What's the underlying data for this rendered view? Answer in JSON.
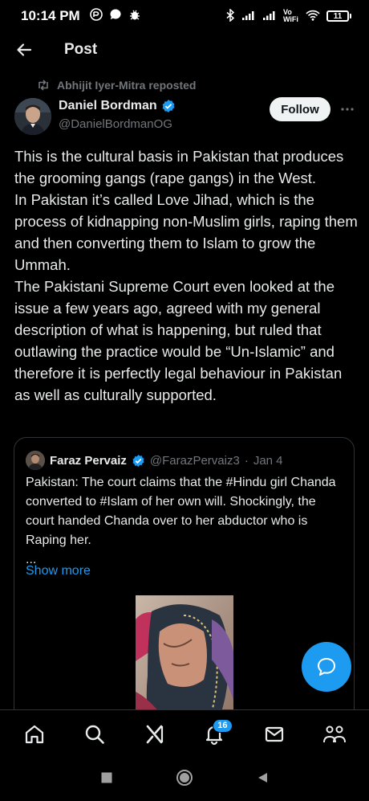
{
  "status_bar": {
    "time": "10:14 PM",
    "network_label": "Vo WiFi",
    "battery": "11"
  },
  "header": {
    "title": "Post"
  },
  "post": {
    "repost_text": "Abhijit Iyer-Mitra reposted",
    "author_name": "Daniel Bordman",
    "author_handle": "@DanielBordmanOG",
    "follow_label": "Follow",
    "paragraphs": [
      "This is the cultural basis in Pakistan that produces the grooming gangs (rape gangs) in the West.",
      "In Pakistan it’s called Love Jihad, which is the process of kidnapping non-Muslim girls, raping them and then converting them to Islam to grow the Ummah.",
      "The Pakistani Supreme Court even looked at the issue a few years ago, agreed with my general description of what is happening, but ruled that outlawing the practice would be “Un-Islamic” and therefore it is perfectly legal behaviour in Pakistan as well as culturally supported."
    ]
  },
  "quote": {
    "author_name": "Faraz Pervaiz",
    "author_handle": "@FarazPervaiz3",
    "separator": "·",
    "date": "Jan 4",
    "text": "Pakistan: The court claims that the #Hindu girl Chanda converted to #Islam of her own will. Shockingly, the court handed Chanda over to her abductor who is Raping her.",
    "ellipsis": "...",
    "show_more": "Show more"
  },
  "bottom_nav": {
    "items": [
      "home-icon",
      "search-icon",
      "grok-icon",
      "notifications-icon",
      "messages-icon",
      "communities-icon"
    ],
    "notification_count": "16"
  },
  "colors": {
    "accent": "#1d9bf0",
    "background": "#000000",
    "text_primary": "#e7e9ea",
    "text_secondary": "#71767b",
    "border": "#2f3336"
  }
}
